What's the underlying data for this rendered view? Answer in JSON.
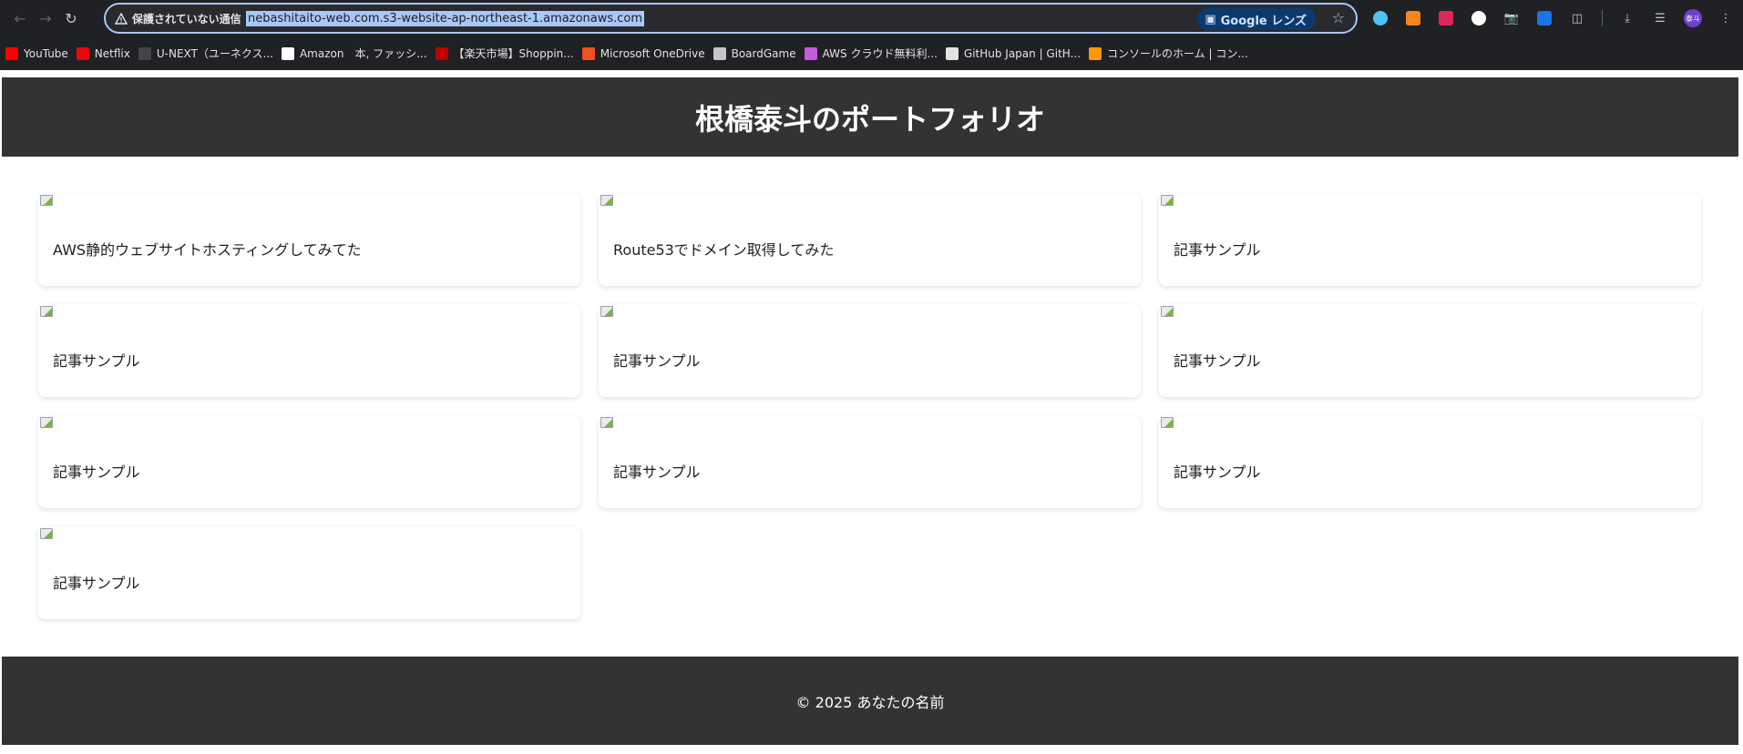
{
  "browser": {
    "security_label": "保護されていない通信",
    "url": "nebashitaito-web.com.s3-website-ap-northeast-1.amazonaws.com",
    "lens_label": "Google レンズ",
    "avatar_label": "泰斗",
    "bookmarks": [
      {
        "label": "YouTube",
        "icon": "youtube-icon",
        "color": "#ff0000"
      },
      {
        "label": "Netflix",
        "icon": "netflix-icon",
        "color": "#e50914"
      },
      {
        "label": "U-NEXT（ユーネクス...",
        "icon": "unext-icon",
        "color": "#444444"
      },
      {
        "label": "Amazon　本, ファッシ...",
        "icon": "amazon-icon",
        "color": "#ffffff"
      },
      {
        "label": "【楽天市場】Shoppin...",
        "icon": "rakuten-icon",
        "color": "#bf0000"
      },
      {
        "label": "Microsoft OneDrive",
        "icon": "microsoft-icon",
        "color": "#f25022"
      },
      {
        "label": "BoardGame",
        "icon": "folder-icon",
        "color": "#c4c7c5"
      },
      {
        "label": "AWS クラウド無料利...",
        "icon": "aws-cube-icon",
        "color": "#c45cdd"
      },
      {
        "label": "GitHub Japan | GitH...",
        "icon": "github-icon",
        "color": "#e3e3e3"
      },
      {
        "label": "コンソールのホーム | コン...",
        "icon": "aws-console-icon",
        "color": "#ff9900"
      }
    ]
  },
  "site": {
    "title": "根橋泰斗のポートフォリオ",
    "cards": [
      {
        "title": "AWS静的ウェブサイトホスティングしてみてた"
      },
      {
        "title": "Route53でドメイン取得してみた"
      },
      {
        "title": "記事サンプル"
      },
      {
        "title": "記事サンプル"
      },
      {
        "title": "記事サンプル"
      },
      {
        "title": "記事サンプル"
      },
      {
        "title": "記事サンプル"
      },
      {
        "title": "記事サンプル"
      },
      {
        "title": "記事サンプル"
      },
      {
        "title": "記事サンプル"
      }
    ],
    "footer": "© 2025 あなたの名前"
  }
}
